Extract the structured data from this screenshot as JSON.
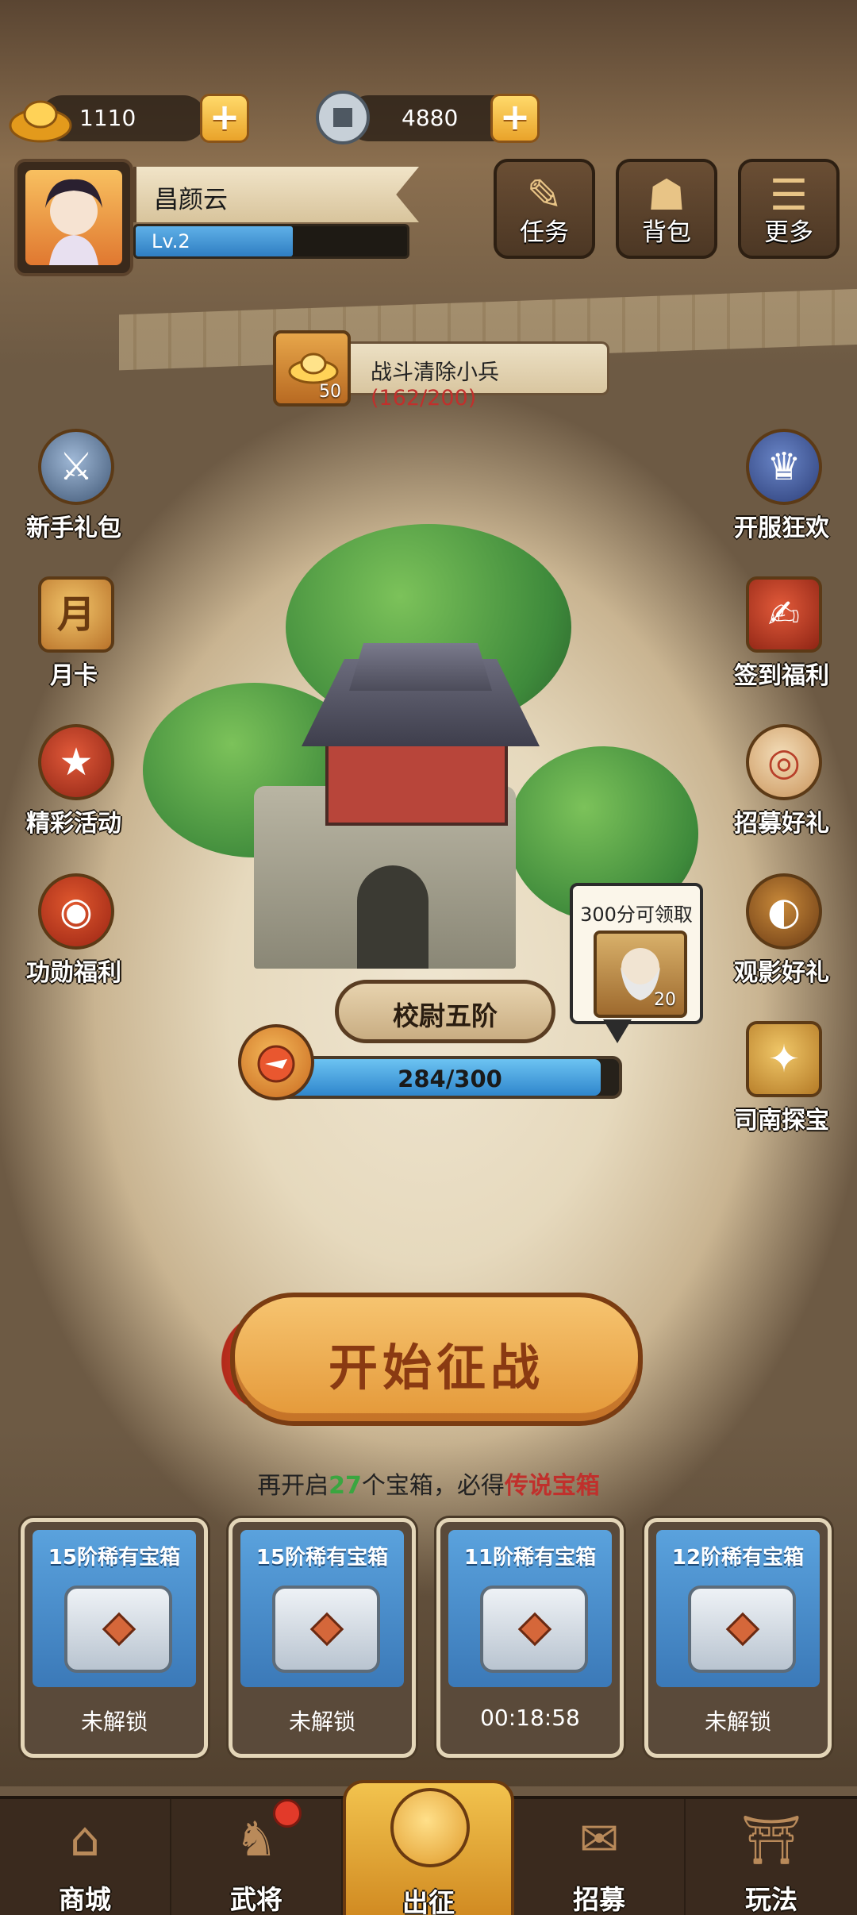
{
  "currency": {
    "gold": {
      "icon": "gold-ingot-icon",
      "amount": "1110"
    },
    "coin": {
      "icon": "copper-coin-icon",
      "amount": "4880"
    },
    "plus_glyph": "+"
  },
  "player": {
    "name": "昌颜云",
    "level": "Lv.2",
    "level_progress": 0.58
  },
  "top_buttons": [
    {
      "icon": "scroll-icon",
      "label": "任务"
    },
    {
      "icon": "bag-icon",
      "label": "背包"
    },
    {
      "icon": "menu-icon",
      "label": "更多"
    }
  ],
  "quest": {
    "reward_count": "50",
    "text": "战斗清除小兵",
    "progress": "(162/200)"
  },
  "left_items": [
    {
      "icon": "warrior-icon",
      "label": "新手礼包"
    },
    {
      "icon": "month-card-icon",
      "label": "月卡",
      "glyph": "月"
    },
    {
      "icon": "gift-bag-icon",
      "label": "精彩活动"
    },
    {
      "icon": "merit-bag-icon",
      "label": "功勋福利"
    }
  ],
  "right_items": [
    {
      "icon": "emperor-icon",
      "label": "开服狂欢"
    },
    {
      "icon": "signin-icon",
      "label": "签到福利"
    },
    {
      "icon": "drum-icon",
      "label": "招募好礼"
    },
    {
      "icon": "compass-icon",
      "label": "观影好礼"
    },
    {
      "icon": "sinan-icon",
      "label": "司南探宝"
    }
  ],
  "rank": {
    "title": "校尉五阶",
    "exp_text": "284/300",
    "exp_progress": 0.947
  },
  "bubble": {
    "title": "300分可领取",
    "reward_count": "20"
  },
  "start_button": {
    "label": "开始征战"
  },
  "chest_hint": {
    "prefix": "再开启",
    "count": "27",
    "middle": "个宝箱，必得",
    "legend": "传说宝箱"
  },
  "chests": [
    {
      "title": "15阶稀有宝箱",
      "status": "未解锁"
    },
    {
      "title": "15阶稀有宝箱",
      "status": "未解锁"
    },
    {
      "title": "11阶稀有宝箱",
      "status": "00:18:58"
    },
    {
      "title": "12阶稀有宝箱",
      "status": "未解锁"
    }
  ],
  "nav": [
    {
      "icon": "shop-icon",
      "label": "商城",
      "glyph": "⌂"
    },
    {
      "icon": "general-icon",
      "label": "武将",
      "glyph": "♞"
    },
    {
      "icon": "expedition-icon",
      "label": "出征",
      "glyph": "",
      "active": true
    },
    {
      "icon": "recruit-icon",
      "label": "招募",
      "glyph": "✉"
    },
    {
      "icon": "gameplay-icon",
      "label": "玩法",
      "glyph": "⛩"
    }
  ],
  "colors": {
    "accent_gold": "#e9a32a",
    "progress_blue": "#2f86cc",
    "highlight_red": "#c0302c",
    "highlight_green": "#3aa640"
  }
}
